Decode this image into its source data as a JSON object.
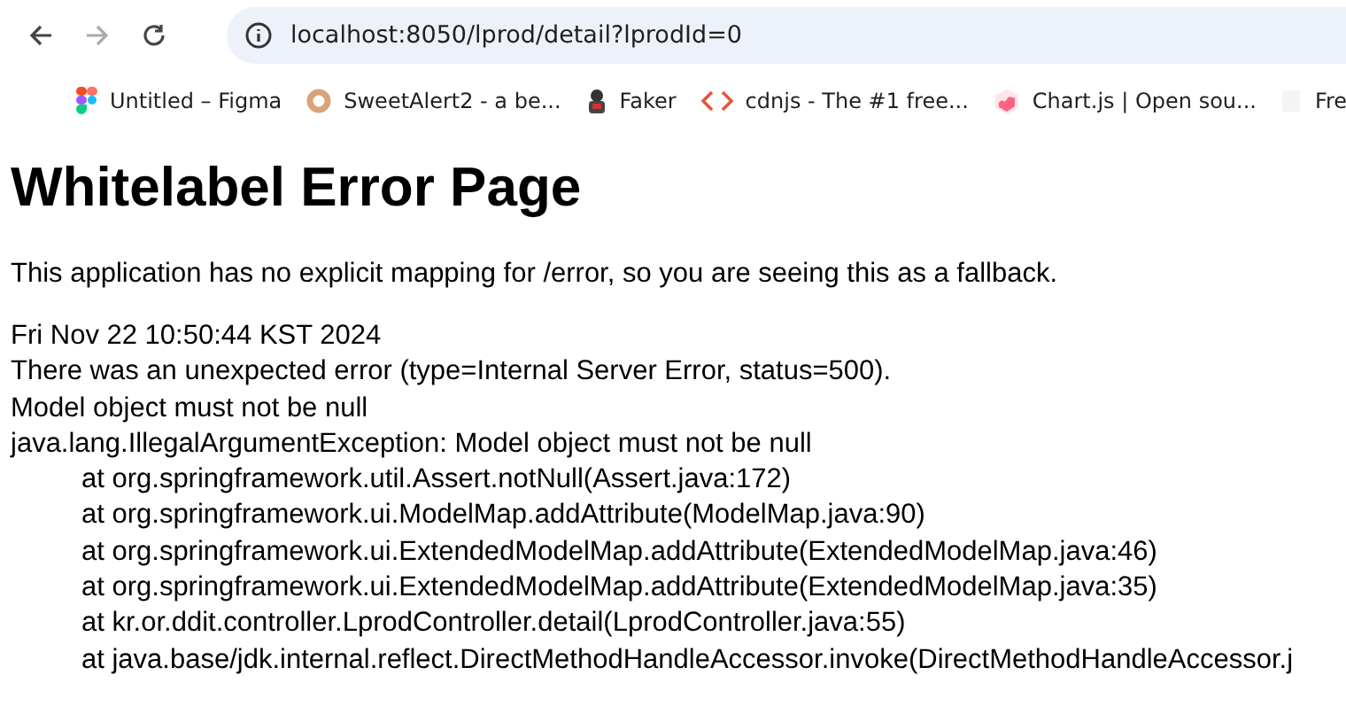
{
  "browser": {
    "url": "localhost:8050/lprod/detail?lprodId=0",
    "bookmarks": [
      {
        "kind": "figma",
        "label": "Untitled – Figma"
      },
      {
        "kind": "donut",
        "label": "SweetAlert2 - a be..."
      },
      {
        "kind": "faker",
        "label": "Faker"
      },
      {
        "kind": "code",
        "label": "cdnjs - The #1 free..."
      },
      {
        "kind": "chart",
        "label": "Chart.js | Open sou..."
      },
      {
        "kind": "blank",
        "label": "Fre"
      }
    ]
  },
  "page": {
    "title": "Whitelabel Error Page",
    "message": "This application has no explicit mapping for /error, so you are seeing this as a fallback.",
    "lines": [
      "Fri Nov 22 10:50:44 KST 2024",
      "There was an unexpected error (type=Internal Server Error, status=500).",
      "Model object must not be null",
      "java.lang.IllegalArgumentException: Model object must not be null"
    ],
    "stack": [
      "at org.springframework.util.Assert.notNull(Assert.java:172)",
      "at org.springframework.ui.ModelMap.addAttribute(ModelMap.java:90)",
      "at org.springframework.ui.ExtendedModelMap.addAttribute(ExtendedModelMap.java:46)",
      "at org.springframework.ui.ExtendedModelMap.addAttribute(ExtendedModelMap.java:35)",
      "at kr.or.ddit.controller.LprodController.detail(LprodController.java:55)",
      "at java.base/jdk.internal.reflect.DirectMethodHandleAccessor.invoke(DirectMethodHandleAccessor.j"
    ]
  }
}
